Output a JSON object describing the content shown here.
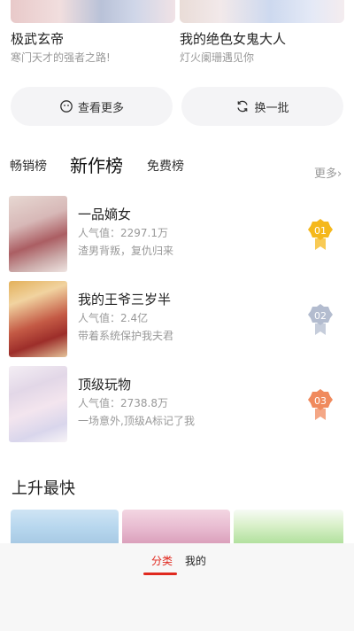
{
  "top_cards": [
    {
      "title": "极武玄帝",
      "desc": "寒门天才的强者之路!"
    },
    {
      "title": "我的绝色女鬼大人",
      "desc": "灯火阑珊遇见你"
    }
  ],
  "actions": {
    "more_label": "查看更多",
    "swap_label": "换一批"
  },
  "rank_tabs": [
    "畅销榜",
    "新作榜",
    "免费榜"
  ],
  "more_link": "更多›",
  "rank_list": [
    {
      "name": "一品嫡女",
      "popularity": "人气值：2297.1万",
      "desc": "渣男背叛，复仇归来",
      "rank": "01",
      "badge_color": "#f5b81c"
    },
    {
      "name": "我的王爷三岁半",
      "popularity": "人气值：2.4亿",
      "desc": "带着系统保护我夫君",
      "rank": "02",
      "badge_color": "#b3bccf"
    },
    {
      "name": "顶级玩物",
      "popularity": "人气值：2738.8万",
      "desc": "一场意外,顶级A标记了我",
      "rank": "03",
      "badge_color": "#f08a5d"
    }
  ],
  "rising_title": "上升最快",
  "bottom_bar": {
    "tabs": [
      "分类",
      "我的"
    ],
    "active_color": "#e0291f"
  }
}
